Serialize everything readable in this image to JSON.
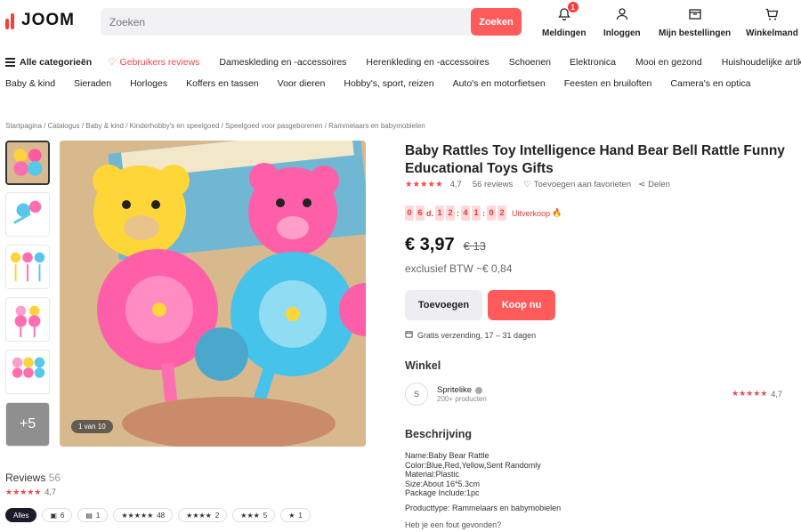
{
  "header": {
    "logo": "JOOM",
    "search_placeholder": "Zoeken",
    "search_button": "Zoeken",
    "notifications": {
      "label": "Meldingen",
      "count": "1"
    },
    "login": "Inloggen",
    "orders": "Mijn bestellingen",
    "cart": "Winkelmand"
  },
  "categories": {
    "all": "Alle categorieën",
    "items": [
      "Gebruikers reviews",
      "Dameskleding en -accessoires",
      "Herenkleding en -accessoires",
      "Schoenen",
      "Elektronica",
      "Mooi en gezond",
      "Huishoudelijke artikelen"
    ],
    "sub": [
      "Baby & kind",
      "Sieraden",
      "Horloges",
      "Koffers en tassen",
      "Voor dieren",
      "Hobby's, sport, reizen",
      "Auto's en motorfietsen",
      "Feesten en bruiloften",
      "Camera's en optica"
    ]
  },
  "breadcrumb": [
    "Startpagina",
    "Catalogus",
    "Baby & kind",
    "Kinderhobby's en speelgoed",
    "Speelgoed voor pasgeborenen",
    "Rammelaars en babymobielen"
  ],
  "gallery": {
    "counter": "1 van 10",
    "more": "+5"
  },
  "product": {
    "title": "Baby Rattles Toy Intelligence Hand Bear Bell Rattle Funny Educational Toys Gifts",
    "rating": "4,7",
    "reviews": "56 reviews",
    "favorite": "Toevoegen aan favorieten",
    "share": "Delen",
    "timer_digits": [
      "0",
      "6",
      "1",
      "2",
      "4",
      "1",
      "0",
      "2"
    ],
    "timer_day": "d.",
    "sale_label": "Uitverkoop",
    "price": "€ 3,97",
    "old_price": "€ 13",
    "vat": "exclusief BTW ~€ 0,84",
    "add_button": "Toevoegen",
    "buy_button": "Koop nu",
    "shipping": "Gratis verzending, 17 – 31 dagen"
  },
  "store": {
    "heading": "Winkel",
    "avatar": "S",
    "name": "Spritelike",
    "count": "200+ producten",
    "rating": "4,7"
  },
  "description": {
    "heading": "Beschrijving",
    "lines": [
      "Name:Baby Bear Rattle",
      "Color:Blue,Red,Yellow,Sent Randomly",
      "Material:Plastic",
      "Size:About 16*5.3cm",
      "Package Include:1pc"
    ],
    "type": "Producttype: Rammelaars en babymobielen",
    "report": "Heb je een fout gevonden?"
  },
  "reviews": {
    "title": "Reviews",
    "count": "56",
    "rating": "4,7",
    "chips": [
      {
        "label": "Alles",
        "icon": ""
      },
      {
        "label": "6",
        "icon": "photo-icon"
      },
      {
        "label": "1",
        "icon": "comment-icon"
      },
      {
        "label": "48",
        "icon": "5-stars"
      },
      {
        "label": "2",
        "icon": "4-stars"
      },
      {
        "label": "5",
        "icon": "3-stars"
      },
      {
        "label": "1",
        "icon": "1-star"
      }
    ]
  },
  "colors": {
    "accent": "#ff5b5b",
    "star": "#f0484f",
    "timer_bg": "#ffd9d9"
  }
}
